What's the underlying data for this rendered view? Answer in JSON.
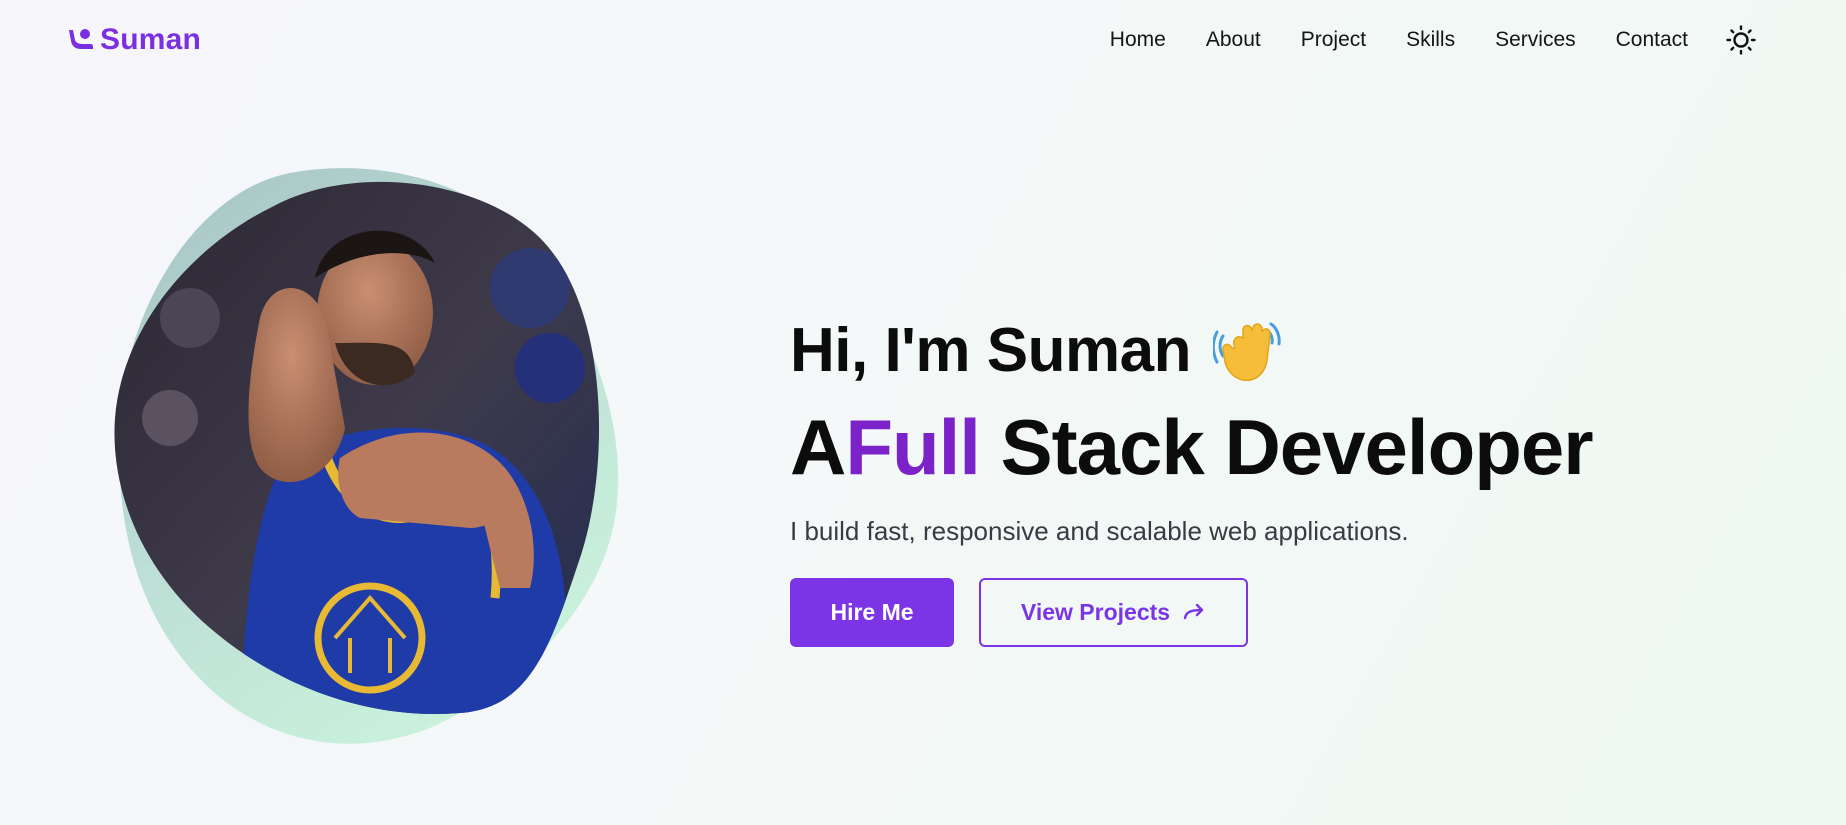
{
  "brand": {
    "name": "Suman",
    "logo_icon": "waving-person-icon",
    "accent_color": "#7b35e6"
  },
  "nav": {
    "items": [
      {
        "label": "Home"
      },
      {
        "label": "About"
      },
      {
        "label": "Project"
      },
      {
        "label": "Skills"
      },
      {
        "label": "Services"
      },
      {
        "label": "Contact"
      }
    ],
    "theme_toggle_icon": "sun-icon"
  },
  "hero": {
    "greeting": "Hi, I'm Suman",
    "greeting_icon": "waving-hand-icon",
    "headline_prefix": "A",
    "headline_accent": "Full",
    "headline_suffix": "Stack Developer",
    "tagline": "I build fast, responsive and scalable web applications.",
    "primary_button": "Hire Me",
    "secondary_button": "View Projects",
    "secondary_button_icon": "arrow-right-icon",
    "portrait_icon": "profile-photo"
  }
}
